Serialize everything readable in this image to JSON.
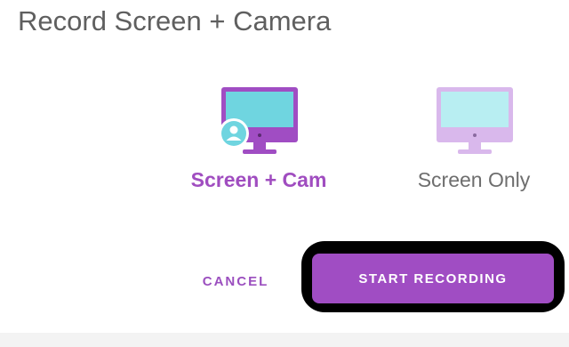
{
  "dialog": {
    "title": "Record Screen + Camera",
    "options": [
      {
        "label": "Screen + Cam",
        "icon": "monitor-with-user-icon",
        "selected": true
      },
      {
        "label": "Screen Only",
        "icon": "monitor-icon",
        "selected": false
      }
    ],
    "cancel_label": "CANCEL",
    "start_label": "START RECORDING"
  },
  "colors": {
    "accent": "#a04dc3",
    "accent_light": "#d9b8ec",
    "screen_teal": "#6fd5e0",
    "screen_teal_light": "#b8eef2"
  }
}
